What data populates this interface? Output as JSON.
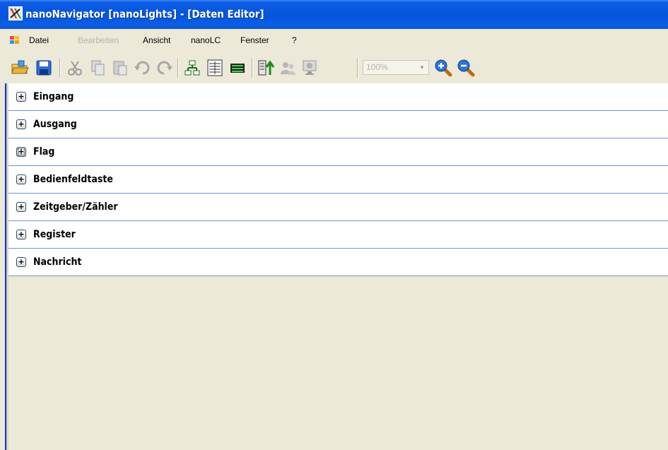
{
  "window": {
    "title": "nanoNavigator [nanoLights] - [Daten Editor]"
  },
  "menubar": {
    "items": [
      {
        "label": "Datei",
        "enabled": true
      },
      {
        "label": "Bearbeiten",
        "enabled": false
      },
      {
        "label": "Ansicht",
        "enabled": true
      },
      {
        "label": "nanoLC",
        "enabled": true
      },
      {
        "label": "Fenster",
        "enabled": true
      },
      {
        "label": "?",
        "enabled": true
      }
    ]
  },
  "toolbar": {
    "buttons": [
      {
        "icon": "open-folder-icon",
        "enabled": true
      },
      {
        "icon": "save-icon",
        "enabled": true
      },
      {
        "icon": "cut-icon",
        "enabled": false
      },
      {
        "icon": "copy-icon",
        "enabled": false
      },
      {
        "icon": "paste-icon",
        "enabled": false
      },
      {
        "icon": "undo-icon",
        "enabled": false
      },
      {
        "icon": "redo-icon",
        "enabled": false
      },
      {
        "icon": "tree-view-icon",
        "enabled": true
      },
      {
        "icon": "data-table-icon",
        "enabled": true
      },
      {
        "icon": "green-bars-icon",
        "enabled": true
      },
      {
        "icon": "upload-icon",
        "enabled": true
      },
      {
        "icon": "users-icon",
        "enabled": false
      },
      {
        "icon": "monitor-icon",
        "enabled": false
      },
      {
        "icon": "zoom-in-icon",
        "enabled": true
      },
      {
        "icon": "zoom-out-icon",
        "enabled": true
      }
    ],
    "zoom_value": "100%"
  },
  "editor": {
    "rows": [
      {
        "label": "Eingang",
        "expander": "+"
      },
      {
        "label": "Ausgang",
        "expander": "+"
      },
      {
        "label": "Flag",
        "expander": "+"
      },
      {
        "label": "Bedienfeldtaste",
        "expander": "+"
      },
      {
        "label": "Zeitgeber/Zähler",
        "expander": "+"
      },
      {
        "label": "Register",
        "expander": "+"
      },
      {
        "label": "Nachricht",
        "expander": "+"
      }
    ]
  },
  "colors": {
    "titlebar": "#0858e0",
    "row_separator": "#6f97d0",
    "background": "#ece9d8"
  }
}
